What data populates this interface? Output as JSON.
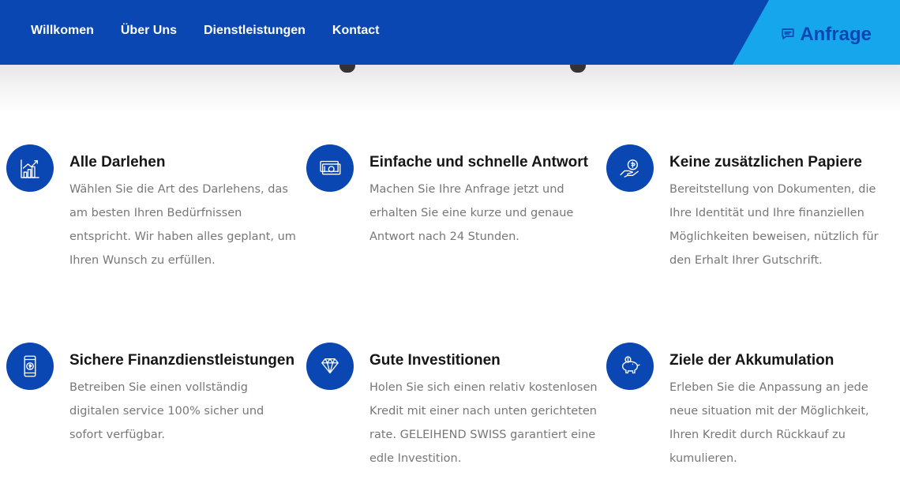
{
  "nav": {
    "items": [
      "Willkomen",
      "Über Uns",
      "Dienstleistungen",
      "Kontact"
    ],
    "cta_label": "Anfrage",
    "cta_icon": "chat-icon"
  },
  "colors": {
    "primary": "#0a47b2",
    "accent": "#16a6ec",
    "title": "#161616",
    "text": "#777777"
  },
  "features": [
    {
      "title": "Alle Darlehen",
      "description": "Wählen Sie die Art des Darlehens, das am besten Ihren Bedürfnissen entspricht. Wir haben alles geplant, um Ihren Wunsch zu erfüllen.",
      "icon": "growth-chart-icon"
    },
    {
      "title": "Einfache und schnelle Antwort",
      "description": "Machen Sie Ihre Anfrage jetzt und erhalten Sie eine kurze und genaue Antwort nach 24 Stunden.",
      "icon": "banknotes-icon"
    },
    {
      "title": "Keine zusätzlichen Papiere",
      "description": "Bereitstellung von Dokumenten, die Ihre Identität und Ihre finanziellen Möglichkeiten beweisen, nützlich für den Erhalt Ihrer Gutschrift.",
      "icon": "money-hand-icon"
    },
    {
      "title": "Sichere Finanzdienstleistungen",
      "description": "Betreiben Sie einen vollständig digitalen service 100% sicher und sofort verfügbar.",
      "icon": "mobile-money-icon"
    },
    {
      "title": "Gute Investitionen",
      "description": "Holen Sie sich einen relativ kostenlosen Kredit mit einer nach unten gerichteten rate. GELEIHEND SWISS garantiert eine edle Investition.",
      "icon": "diamond-icon"
    },
    {
      "title": "Ziele der Akkumulation",
      "description": "Erleben Sie die Anpassung an jede neue situation mit der Möglichkeit, Ihren Kredit durch Rückkauf zu kumulieren.",
      "icon": "piggy-bank-icon"
    }
  ]
}
